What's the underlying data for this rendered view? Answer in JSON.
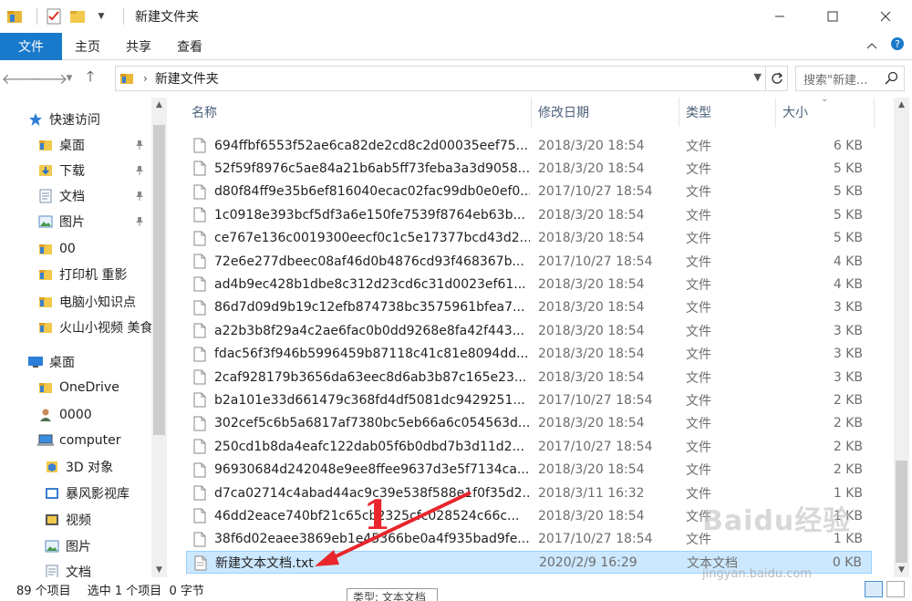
{
  "window": {
    "title": "新建文件夹",
    "accent": "#1979ca"
  },
  "ribbon": {
    "tabs": [
      {
        "label": "文件"
      },
      {
        "label": "主页"
      },
      {
        "label": "共享"
      },
      {
        "label": "查看"
      }
    ]
  },
  "address": {
    "path": "新建文件夹",
    "search_placeholder": "搜索\"新建..."
  },
  "nav": {
    "items": [
      {
        "label": "快速访问",
        "icon": "star-icon"
      },
      {
        "label": "桌面",
        "icon": "folder-icon",
        "pinned": true
      },
      {
        "label": "下载",
        "icon": "download-icon",
        "pinned": true
      },
      {
        "label": "文档",
        "icon": "document-icon",
        "pinned": true
      },
      {
        "label": "图片",
        "icon": "picture-icon",
        "pinned": true
      },
      {
        "label": "00",
        "icon": "folder-icon"
      },
      {
        "label": "打印机 重影",
        "icon": "folder-icon"
      },
      {
        "label": "电脑小知识点",
        "icon": "folder-icon"
      },
      {
        "label": "火山小视频 美食",
        "icon": "folder-icon"
      },
      {
        "label": "桌面",
        "icon": "desktop-icon"
      },
      {
        "label": "OneDrive",
        "icon": "folder-icon"
      },
      {
        "label": "0000",
        "icon": "user-icon"
      },
      {
        "label": "computer",
        "icon": "computer-icon"
      },
      {
        "label": "3D 对象",
        "icon": "3d-objects-icon"
      },
      {
        "label": "暴风影视库",
        "icon": "video-library-icon"
      },
      {
        "label": "视频",
        "icon": "video-icon"
      },
      {
        "label": "图片",
        "icon": "picture-icon"
      },
      {
        "label": "文档",
        "icon": "document-icon"
      }
    ]
  },
  "list": {
    "headers": {
      "name": "名称",
      "date": "修改日期",
      "type": "类型",
      "size": "大小"
    },
    "rows": [
      {
        "name": "694ffbf6553f52ae6ca82de2cd8c2d00035eef75...",
        "date": "2018/3/20 18:54",
        "type": "文件",
        "size": "6 KB"
      },
      {
        "name": "52f59f8976c5ae84a21b6ab5ff73feba3a3d9058...",
        "date": "2018/3/20 18:54",
        "type": "文件",
        "size": "5 KB"
      },
      {
        "name": "d80f84ff9e35b6ef816040ecac02fac99db0e0ef0...",
        "date": "2017/10/27 18:54",
        "type": "文件",
        "size": "5 KB"
      },
      {
        "name": "1c0918e393bcf5df3a6e150fe7539f8764eb63b...",
        "date": "2018/3/20 18:54",
        "type": "文件",
        "size": "5 KB"
      },
      {
        "name": "ce767e136c0019300eecf0c1c5e17377bcd43d2...",
        "date": "2018/3/20 18:54",
        "type": "文件",
        "size": "5 KB"
      },
      {
        "name": "72e6e277dbeec08af46d0b4876cd93f468367b...",
        "date": "2017/10/27 18:54",
        "type": "文件",
        "size": "4 KB"
      },
      {
        "name": "ad4b9ec428b1dbe8c312d23cd6c31d0023ef61...",
        "date": "2018/3/20 18:54",
        "type": "文件",
        "size": "4 KB"
      },
      {
        "name": "86d7d09d9b19c12efb874738bc3575961bfea7...",
        "date": "2018/3/20 18:54",
        "type": "文件",
        "size": "3 KB"
      },
      {
        "name": "a22b3b8f29a4c2ae6fac0b0dd9268e8fa42f443...",
        "date": "2018/3/20 18:54",
        "type": "文件",
        "size": "3 KB"
      },
      {
        "name": "fdac56f3f946b5996459b87118c41c81e8094dd...",
        "date": "2018/3/20 18:54",
        "type": "文件",
        "size": "3 KB"
      },
      {
        "name": "2caf928179b3656da63eec8d6ab3b87c165e23...",
        "date": "2018/3/20 18:54",
        "type": "文件",
        "size": "3 KB"
      },
      {
        "name": "b2a101e33d661479c368fd4df5081dc9429251...",
        "date": "2017/10/27 18:54",
        "type": "文件",
        "size": "2 KB"
      },
      {
        "name": "302cef5c6b5a6817af7380bc5eb66a6c054563d...",
        "date": "2018/3/20 18:54",
        "type": "文件",
        "size": "2 KB"
      },
      {
        "name": "250cd1b8da4eafc122dab05f6b0dbd7b3d11d2...",
        "date": "2017/10/27 18:54",
        "type": "文件",
        "size": "2 KB"
      },
      {
        "name": "96930684d242048e9ee8ffee9637d3e5f7134ca...",
        "date": "2018/3/20 18:54",
        "type": "文件",
        "size": "2 KB"
      },
      {
        "name": "d7ca02714c4abad44ac9c39e538f588e1f0f35d2...",
        "date": "2018/3/11 16:32",
        "type": "文件",
        "size": "1 KB"
      },
      {
        "name": "46dd2eace740bf21c65cb2325cfc028524c66c...",
        "date": "2018/3/20 18:54",
        "type": "文件",
        "size": "1 KB"
      },
      {
        "name": "38f6d02eaee3869eb1e45366be0a4f935bad9fe...",
        "date": "2017/10/27 18:54",
        "type": "文件",
        "size": "1 KB"
      },
      {
        "name": "新建文本文档.txt",
        "date": "2020/2/9 16:29",
        "type": "文本文档",
        "size": "0 KB",
        "selected": true
      }
    ]
  },
  "status": {
    "count": "89 个项目",
    "selection": "选中 1 个项目  0 字节",
    "tooltip": "类型: 文本文档"
  },
  "annotation": {
    "number": "1",
    "color": "#e8262c"
  },
  "watermark": {
    "logo_text": "Baidu经验",
    "url": "jingyan.baidu.com"
  }
}
